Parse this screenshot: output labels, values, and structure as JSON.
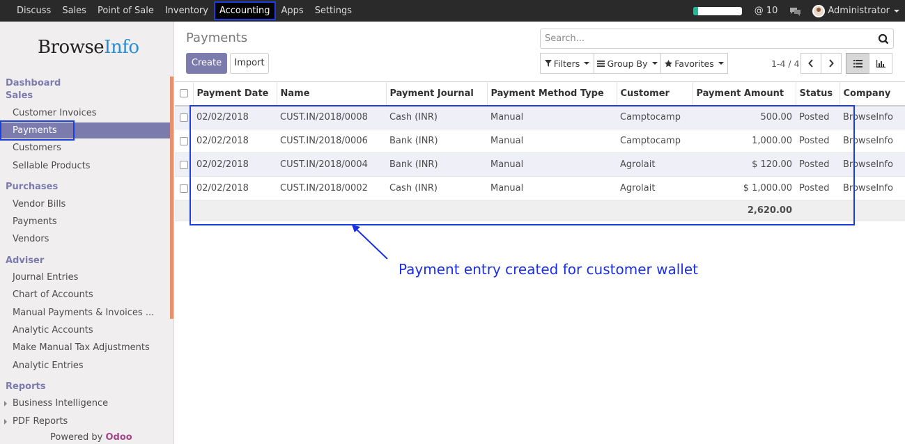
{
  "topbar": {
    "menu": [
      "Discuss",
      "Sales",
      "Point of Sale",
      "Inventory",
      "Accounting",
      "Apps",
      "Settings"
    ],
    "active_menu": "Accounting",
    "progress": 0.1,
    "mentions": "@ 10",
    "user": "Administrator"
  },
  "sidebar": {
    "brand_a": "Browse",
    "brand_b": "Info",
    "dashboard": "Dashboard",
    "sales": "Sales",
    "customer_invoices": "Customer Invoices",
    "payments": "Payments",
    "customers": "Customers",
    "sellable_products": "Sellable Products",
    "purchases": "Purchases",
    "vendor_bills": "Vendor Bills",
    "purchase_payments": "Payments",
    "vendors": "Vendors",
    "adviser": "Adviser",
    "journal_entries": "Journal Entries",
    "chart_of_accounts": "Chart of Accounts",
    "manual_payments": "Manual Payments & Invoices ...",
    "analytic_accounts": "Analytic Accounts",
    "manual_tax": "Make Manual Tax Adjustments",
    "analytic_entries": "Analytic Entries",
    "reports": "Reports",
    "business_intelligence": "Business Intelligence",
    "pdf_reports": "PDF Reports",
    "powered_by": "Powered by",
    "odoo": "Odoo"
  },
  "main": {
    "title": "Payments",
    "create_label": "Create",
    "import_label": "Import",
    "search_placeholder": "Search...",
    "filters_label": "Filters",
    "groupby_label": "Group By",
    "favorites_label": "Favorites",
    "pager": "1-4 / 4"
  },
  "table": {
    "headers": [
      "Payment Date",
      "Name",
      "Payment Journal",
      "Payment Method Type",
      "Customer",
      "Payment Amount",
      "Status",
      "Company"
    ],
    "rows": [
      [
        "02/02/2018",
        "CUST.IN/2018/0008",
        "Cash (INR)",
        "Manual",
        "Camptocamp",
        "500.00",
        "Posted",
        "BrowseInfo"
      ],
      [
        "02/02/2018",
        "CUST.IN/2018/0006",
        "Bank (INR)",
        "Manual",
        "Camptocamp",
        "1,000.00",
        "Posted",
        "BrowseInfo"
      ],
      [
        "02/02/2018",
        "CUST.IN/2018/0004",
        "Bank (INR)",
        "Manual",
        "Agrolait",
        "$ 120.00",
        "Posted",
        "BrowseInfo"
      ],
      [
        "02/02/2018",
        "CUST.IN/2018/0002",
        "Cash (INR)",
        "Manual",
        "Agrolait",
        "$ 1,000.00",
        "Posted",
        "BrowseInfo"
      ]
    ],
    "total": "2,620.00"
  },
  "annotation": "Payment entry created for customer wallet",
  "colors": {
    "topbar": "#2a2a2a",
    "accent": "#7c7bad",
    "highlight": "#1a3ee0",
    "annotation": "#1a2ee6",
    "progress": "#21b799"
  }
}
